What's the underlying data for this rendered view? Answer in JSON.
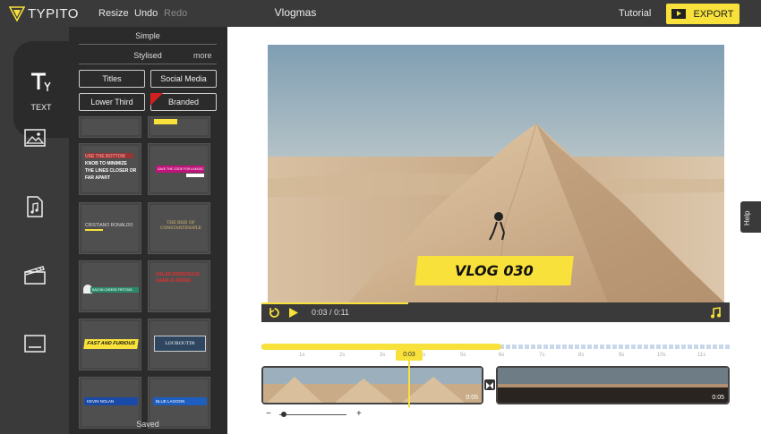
{
  "app": {
    "logo_text": "TYPITO",
    "project_title": "Vlogmas"
  },
  "toolbar": {
    "resize_label": "Resize",
    "undo_label": "Undo",
    "redo_label": "Redo",
    "tutorial_label": "Tutorial",
    "export_label": "EXPORT"
  },
  "rail": {
    "items": [
      {
        "name": "text",
        "label": "TEXT",
        "icon": "text-icon",
        "active": true
      },
      {
        "name": "images",
        "icon": "image-icon"
      },
      {
        "name": "audio",
        "icon": "music-file-icon"
      },
      {
        "name": "video",
        "icon": "clapperboard-icon"
      },
      {
        "name": "subtitles",
        "icon": "subtitle-icon"
      }
    ]
  },
  "panel": {
    "tab_simple": "Simple",
    "tab_stylised": "Stylised",
    "more_label": "more",
    "categories": [
      "Titles",
      "Social Media",
      "Lower Third",
      "Branded"
    ],
    "templates": [
      {
        "text": "USE THE BOTTOM KNOB TO MINIMIZE THE LINES CLOSER OR FAR APART"
      },
      {
        "text": "SAVE THE CODE FOR A MAGIC"
      },
      {
        "text": "CRISTIANO RONALDO"
      },
      {
        "text": "THE RISE OF CONSTANTINOPLE"
      },
      {
        "text": "BACON CHEESE FRITTATA"
      },
      {
        "text": "VALAR MORGHULIS DAME IS RISING"
      },
      {
        "text": "FAST AND FURIOUS"
      },
      {
        "text": "LOUBOUTIN"
      },
      {
        "text": "KEVIN NOLAN"
      },
      {
        "text": "BLUE LAGOON"
      }
    ],
    "saved_label": "Saved"
  },
  "player": {
    "overlay_text": "VLOG 030",
    "current_time": "0:03",
    "separator": "/",
    "total_time": "0:11",
    "progress": 0.27
  },
  "timeline": {
    "ticks": [
      "1s",
      "2s",
      "3s",
      "4s",
      "5s",
      "6s",
      "7s",
      "8s",
      "9s",
      "10s",
      "11s"
    ],
    "playhead_label": "0:03",
    "clips": [
      {
        "duration_label": "0:05"
      },
      {
        "duration_label": "0:05"
      }
    ],
    "zoom_minus": "−",
    "zoom_plus": "+"
  },
  "help": {
    "label": "Help"
  },
  "colors": {
    "accent": "#f7e13a",
    "dark": "#2b2b2b",
    "chrome": "#3a3a3a"
  }
}
